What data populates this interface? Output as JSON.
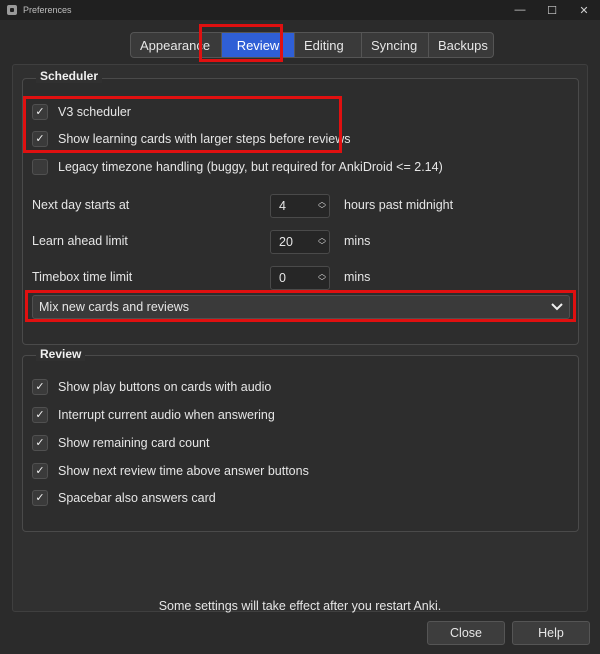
{
  "window": {
    "title": "Preferences",
    "controls": {
      "minimize": "—",
      "maximize": "☐",
      "close": "✕"
    }
  },
  "tabs": [
    {
      "label": "Appearance"
    },
    {
      "label": "Review"
    },
    {
      "label": "Editing"
    },
    {
      "label": "Syncing"
    },
    {
      "label": "Backups"
    }
  ],
  "scheduler": {
    "title": "Scheduler",
    "options": [
      {
        "label": "V3 scheduler",
        "checked": true
      },
      {
        "label": "Show learning cards with larger steps before reviews",
        "checked": true
      },
      {
        "label": "Legacy timezone handling (buggy, but required for AnkiDroid <= 2.14)",
        "checked": false
      }
    ],
    "spinners": [
      {
        "label": "Next day starts at",
        "value": "4",
        "unit": "hours past midnight"
      },
      {
        "label": "Learn ahead limit",
        "value": "20",
        "unit": "mins"
      },
      {
        "label": "Timebox time limit",
        "value": "0",
        "unit": "mins"
      }
    ],
    "mix_select": {
      "value": "Mix new cards and reviews"
    }
  },
  "review": {
    "title": "Review",
    "options": [
      {
        "label": "Show play buttons on cards with audio",
        "checked": true
      },
      {
        "label": "Interrupt current audio when answering",
        "checked": true
      },
      {
        "label": "Show remaining card count",
        "checked": true
      },
      {
        "label": "Show next review time above answer buttons",
        "checked": true
      },
      {
        "label": "Spacebar also answers card",
        "checked": true
      }
    ]
  },
  "footer": {
    "note": "Some settings will take effect after you restart Anki.",
    "close_label": "Close",
    "help_label": "Help"
  },
  "colors": {
    "accent": "#2f5fd6",
    "highlight": "#e01010",
    "background": "#2b2b2b"
  }
}
